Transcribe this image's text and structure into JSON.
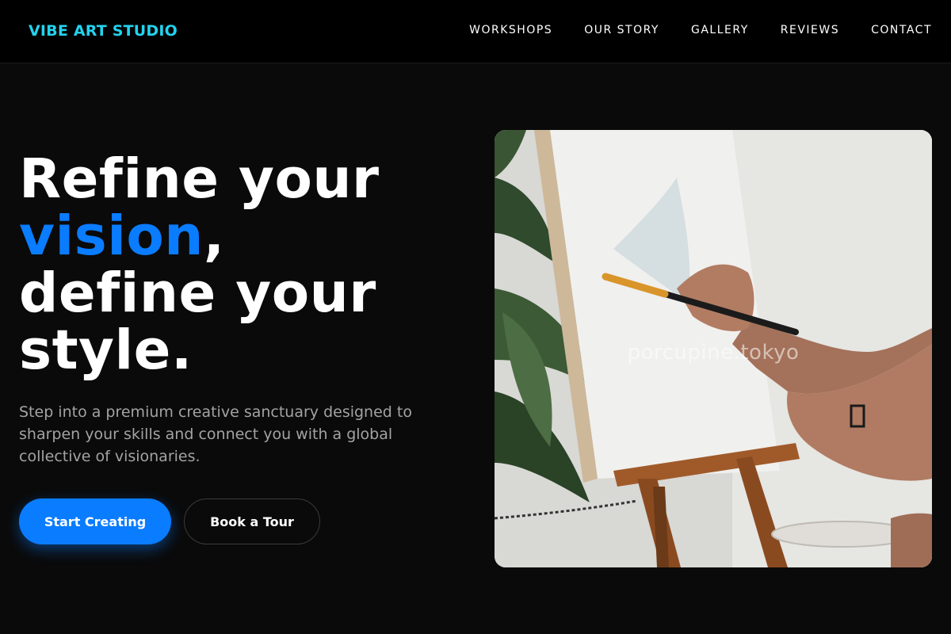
{
  "brand": {
    "name": "VIBE ART STUDIO",
    "color": "#22d3ee"
  },
  "nav": {
    "items": [
      {
        "label": "WORKSHOPS"
      },
      {
        "label": "OUR STORY"
      },
      {
        "label": "GALLERY"
      },
      {
        "label": "REVIEWS"
      },
      {
        "label": "CONTACT"
      }
    ]
  },
  "hero": {
    "headline": {
      "line1": "Refine your",
      "accent_word": "vision",
      "comma": ",",
      "line3": "define your",
      "line4": "style."
    },
    "subtext": "Step into a premium creative sanctuary designed to sharpen your skills and connect you with a global collective of visionaries.",
    "primary_button": "Start Creating",
    "secondary_button": "Book a Tour",
    "image": {
      "alt_icon": "painting-photo",
      "watermark": "porcupine.tokyo"
    }
  },
  "colors": {
    "accent": "#0a7cff",
    "background": "#0a0a0a",
    "nav_background": "#000000",
    "muted_text": "#a3a3a3"
  }
}
